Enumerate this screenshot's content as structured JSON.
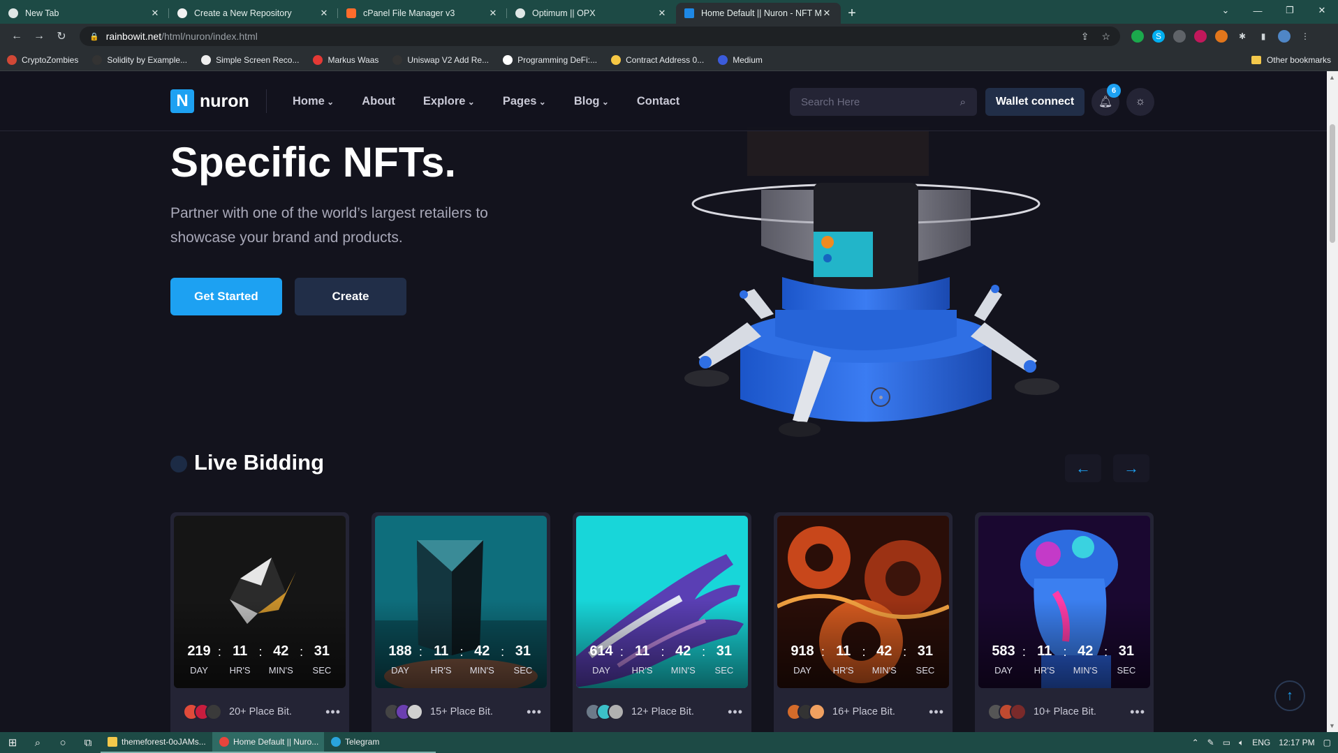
{
  "browser": {
    "tabs": [
      {
        "label": "New Tab",
        "icon": "chrome-icon"
      },
      {
        "label": "Create a New Repository",
        "icon": "github-icon"
      },
      {
        "label": "cPanel File Manager v3",
        "icon": "cpanel-icon"
      },
      {
        "label": "Optimum || OPX",
        "icon": "globe-icon"
      },
      {
        "label": "Home Default || Nuron - NFT Marketplace",
        "icon": "nuron-icon"
      }
    ],
    "url_host": "rainbowit.net",
    "url_path": "/html/nuron/index.html",
    "bookmarks": [
      "CryptoZombies",
      "Solidity by Example...",
      "Simple Screen Reco...",
      "Markus Waas",
      "Uniswap V2 Add Re...",
      "Programming DeFi:...",
      "Contract Address 0...",
      "Medium"
    ],
    "other_bookmarks": "Other bookmarks"
  },
  "site": {
    "logo_letter": "N",
    "logo_text": "nuron",
    "nav": [
      "Home",
      "About",
      "Explore",
      "Pages",
      "Blog",
      "Contact"
    ],
    "search_placeholder": "Search Here",
    "wallet_label": "Wallet connect",
    "notification_count": "6"
  },
  "hero": {
    "title": "Specific NFTs.",
    "description": "Partner with one of the world’s largest retailers to showcase your brand and products.",
    "primary_button": "Get Started",
    "secondary_button": "Create"
  },
  "live_bidding": {
    "title": "Live Bidding",
    "labels": {
      "day": "DAY",
      "hours": "HR'S",
      "minutes": "MIN'S",
      "seconds": "SEC"
    },
    "cards": [
      {
        "day": "219",
        "hours": "11",
        "minutes": "42",
        "seconds": "31",
        "bid": "20+ Place Bit.",
        "art": "black-gem"
      },
      {
        "day": "188",
        "hours": "11",
        "minutes": "42",
        "seconds": "31",
        "bid": "15+ Place Bit.",
        "art": "teal-prism"
      },
      {
        "day": "614",
        "hours": "11",
        "minutes": "42",
        "seconds": "31",
        "bid": "12+ Place Bit.",
        "art": "holographic-hand"
      },
      {
        "day": "918",
        "hours": "11",
        "minutes": "42",
        "seconds": "31",
        "bid": "16+ Place Bit.",
        "art": "orange-swirl"
      },
      {
        "day": "583",
        "hours": "11",
        "minutes": "42",
        "seconds": "31",
        "bid": "10+ Place Bit.",
        "art": "neon-bust"
      }
    ]
  },
  "taskbar": {
    "apps": [
      "themeforest-0oJAMs...",
      "Home Default || Nuro...",
      "Telegram"
    ],
    "language": "ENG",
    "time": "12:17 PM"
  },
  "colors": {
    "accent": "#1da1f2",
    "background": "#13131d",
    "card": "#242435",
    "button_dark": "#212e48"
  }
}
